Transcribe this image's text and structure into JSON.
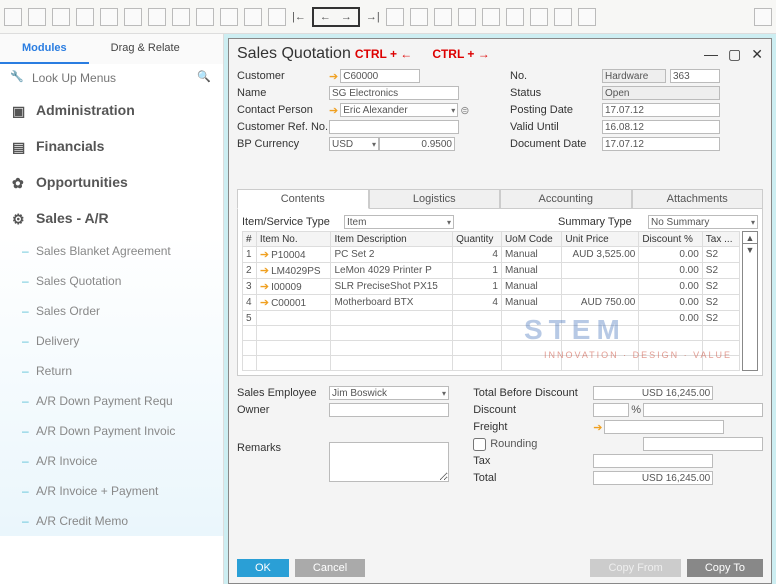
{
  "toolbar_icons": [
    "print",
    "save",
    "export",
    "doc",
    "copy",
    "excel",
    "word",
    "pdf",
    "fit",
    "layout",
    "grid",
    "tools",
    "first",
    "prev",
    "next",
    "last",
    "cut",
    "filter",
    "sort",
    "sum",
    "form",
    "view",
    "find",
    "settings",
    "link",
    "edit"
  ],
  "sidebar": {
    "tabs": [
      "Modules",
      "Drag & Relate"
    ],
    "search_placeholder": "Look Up Menus",
    "groups": [
      {
        "label": "Administration"
      },
      {
        "label": "Financials"
      },
      {
        "label": "Opportunities"
      },
      {
        "label": "Sales - A/R",
        "items": [
          "Sales Blanket Agreement",
          "Sales Quotation",
          "Sales Order",
          "Delivery",
          "Return",
          "A/R Down Payment Requ",
          "A/R Down Payment Invoic",
          "A/R Invoice",
          "A/R Invoice + Payment",
          "A/R Credit Memo"
        ]
      }
    ]
  },
  "window": {
    "title": "Sales Quotation",
    "ctrl_left": "CTRL + ←",
    "ctrl_right": "CTRL + →",
    "left": {
      "customer_lbl": "Customer",
      "customer": "C60000",
      "name_lbl": "Name",
      "name": "SG Electronics",
      "contact_lbl": "Contact Person",
      "contact": "Eric Alexander",
      "ref_lbl": "Customer Ref. No.",
      "ref": "",
      "curr_lbl": "BP Currency",
      "curr": "USD",
      "rate": "0.9500"
    },
    "right": {
      "no_lbl": "No.",
      "series": "Hardware",
      "no": "363",
      "status_lbl": "Status",
      "status": "Open",
      "postdate_lbl": "Posting Date",
      "postdate": "17.07.12",
      "valid_lbl": "Valid Until",
      "valid": "16.08.12",
      "docdate_lbl": "Document Date",
      "docdate": "17.07.12"
    },
    "tabs": [
      "Contents",
      "Logistics",
      "Accounting",
      "Attachments"
    ],
    "itemtype_lbl": "Item/Service Type",
    "itemtype": "Item",
    "sumtype_lbl": "Summary Type",
    "sumtype": "No Summary",
    "cols": [
      "#",
      "Item No.",
      "Item Description",
      "Quantity",
      "UoM Code",
      "Unit Price",
      "Discount %",
      "Tax ..."
    ],
    "rows": [
      {
        "n": "1",
        "item": "P10004",
        "desc": "PC Set 2",
        "qty": "4",
        "uom": "Manual",
        "price": "AUD 3,525.00",
        "disc": "0.00",
        "tax": "S2"
      },
      {
        "n": "2",
        "item": "LM4029PS",
        "desc": "LeMon 4029 Printer P",
        "qty": "1",
        "uom": "Manual",
        "price": "",
        "disc": "0.00",
        "tax": "S2"
      },
      {
        "n": "3",
        "item": "I00009",
        "desc": "SLR PreciseShot PX15",
        "qty": "1",
        "uom": "Manual",
        "price": "",
        "disc": "0.00",
        "tax": "S2"
      },
      {
        "n": "4",
        "item": "C00001",
        "desc": "Motherboard BTX",
        "qty": "4",
        "uom": "Manual",
        "price": "AUD 750.00",
        "disc": "0.00",
        "tax": "S2"
      },
      {
        "n": "5",
        "item": "",
        "desc": "",
        "qty": "",
        "uom": "",
        "price": "",
        "disc": "0.00",
        "tax": "S2"
      }
    ],
    "watermark": "STEM",
    "watermark2": "INNOVATION · DESIGN · VALUE",
    "emp_lbl": "Sales Employee",
    "emp": "Jim Boswick",
    "owner_lbl": "Owner",
    "owner": "",
    "remarks_lbl": "Remarks",
    "remarks": "",
    "tbd_lbl": "Total Before Discount",
    "tbd": "USD 16,245.00",
    "disc_lbl": "Discount",
    "disc_pct": "",
    "pct": "%",
    "freight_lbl": "Freight",
    "rounding_lbl": "Rounding",
    "tax_lbl": "Tax",
    "total_lbl": "Total",
    "total": "USD 16,245.00",
    "ok": "OK",
    "cancel": "Cancel",
    "copyfrom": "Copy From",
    "copyto": "Copy To"
  }
}
